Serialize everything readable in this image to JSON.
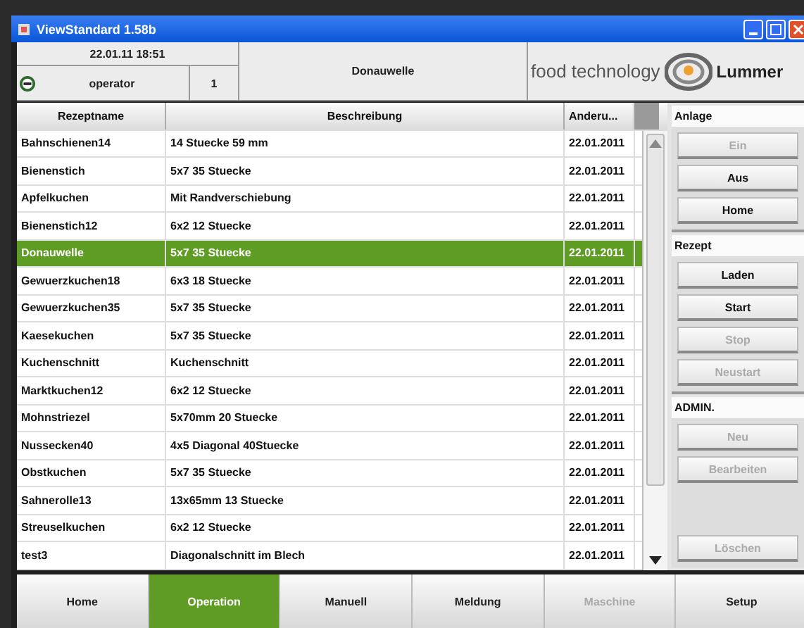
{
  "window": {
    "title": "ViewStandard 1.58b"
  },
  "header": {
    "datetime": "22.01.11 18:51",
    "user": "operator",
    "station": "1",
    "recipe": "Donauwelle",
    "logo_text": "food technology",
    "logo_brand": "Lummer"
  },
  "table": {
    "columns": [
      "Rezeptname",
      "Beschreibung",
      "Anderu..."
    ],
    "rows": [
      {
        "cells": [
          "Bahnschienen14",
          "14 Stuecke 59 mm",
          "22.01.2011"
        ],
        "selected": false
      },
      {
        "cells": [
          "Bienenstich",
          "5x7 35 Stuecke",
          "22.01.2011"
        ],
        "selected": false
      },
      {
        "cells": [
          "Apfelkuchen",
          "Mit Randverschiebung",
          "22.01.2011"
        ],
        "selected": false
      },
      {
        "cells": [
          "Bienenstich12",
          "6x2 12 Stuecke",
          "22.01.2011"
        ],
        "selected": false
      },
      {
        "cells": [
          "Donauwelle",
          "5x7 35 Stuecke",
          "22.01.2011"
        ],
        "selected": true
      },
      {
        "cells": [
          "Gewuerzkuchen18",
          "6x3 18 Stuecke",
          "22.01.2011"
        ],
        "selected": false
      },
      {
        "cells": [
          "Gewuerzkuchen35",
          "5x7 35 Stuecke",
          "22.01.2011"
        ],
        "selected": false
      },
      {
        "cells": [
          "Kaesekuchen",
          "5x7 35 Stuecke",
          "22.01.2011"
        ],
        "selected": false
      },
      {
        "cells": [
          "Kuchenschnitt",
          "Kuchenschnitt",
          "22.01.2011"
        ],
        "selected": false
      },
      {
        "cells": [
          "Marktkuchen12",
          "6x2 12 Stuecke",
          "22.01.2011"
        ],
        "selected": false
      },
      {
        "cells": [
          "Mohnstriezel",
          "5x70mm 20 Stuecke",
          "22.01.2011"
        ],
        "selected": false
      },
      {
        "cells": [
          "Nussecken40",
          "4x5 Diagonal 40Stuecke",
          "22.01.2011"
        ],
        "selected": false
      },
      {
        "cells": [
          "Obstkuchen",
          "5x7 35 Stuecke",
          "22.01.2011"
        ],
        "selected": false
      },
      {
        "cells": [
          "Sahnerolle13",
          "13x65mm 13 Stuecke",
          "22.01.2011"
        ],
        "selected": false
      },
      {
        "cells": [
          "Streuselkuchen",
          "6x2 12 Stuecke",
          "22.01.2011"
        ],
        "selected": false
      },
      {
        "cells": [
          "test3",
          "Diagonalschnitt im Blech",
          "22.01.2011"
        ],
        "selected": false
      }
    ]
  },
  "side_panel": [
    {
      "title": "Anlage",
      "buttons": [
        {
          "label": "Ein",
          "disabled": true
        },
        {
          "label": "Aus",
          "disabled": false
        },
        {
          "label": "Home",
          "disabled": false
        }
      ]
    },
    {
      "title": "Rezept",
      "buttons": [
        {
          "label": "Laden",
          "disabled": false
        },
        {
          "label": "Start",
          "disabled": false
        },
        {
          "label": "Stop",
          "disabled": true
        },
        {
          "label": "Neustart",
          "disabled": true
        }
      ]
    },
    {
      "title": "ADMIN.",
      "buttons": [
        {
          "label": "Neu",
          "disabled": true
        },
        {
          "label": "Bearbeiten",
          "disabled": true
        },
        {
          "label": "Löschen",
          "disabled": true
        }
      ]
    }
  ],
  "nav_tabs": [
    {
      "label": "Home",
      "selected": false,
      "disabled": false
    },
    {
      "label": "Operation",
      "selected": true,
      "disabled": false
    },
    {
      "label": "Manuell",
      "selected": false,
      "disabled": false
    },
    {
      "label": "Meldung",
      "selected": false,
      "disabled": false
    },
    {
      "label": "Maschine",
      "selected": false,
      "disabled": true
    },
    {
      "label": "Setup",
      "selected": false,
      "disabled": false
    }
  ]
}
